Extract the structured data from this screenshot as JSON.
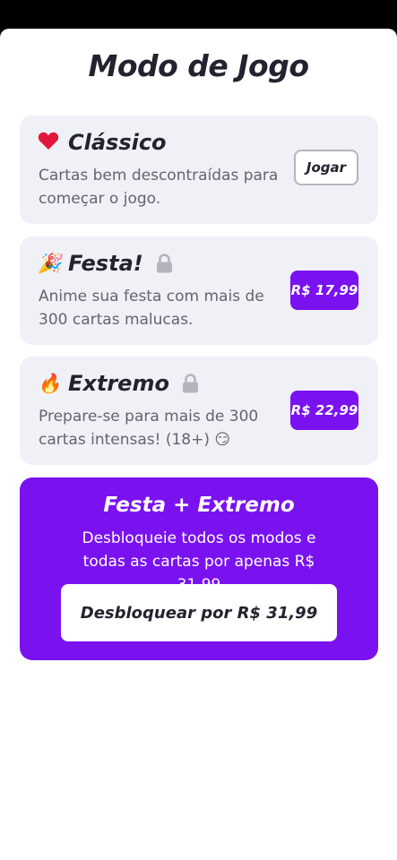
{
  "page_title": "Modo de Jogo",
  "cards": [
    {
      "title": "Clássico",
      "emoji": "❤",
      "description": "Cartas bem descontraídas para começar o jogo.",
      "action_label": "Jogar"
    },
    {
      "title": "Festa!",
      "emoji": "🎉",
      "description": "Anime sua festa com mais de 300 cartas malucas.",
      "action_label": "R$ 17,99",
      "locked": true
    },
    {
      "title": "Extremo",
      "emoji": "🔥",
      "description": "Prepare-se para mais de 300 cartas intensas! (18+) 😏",
      "action_label": "R$ 22,99",
      "locked": true
    }
  ],
  "bundle": {
    "title": "Festa + Extremo",
    "description": "Desbloqueie todos os modos e todas as cartas por apenas R$ 31,99",
    "button_label": "Desbloquear por R$ 31,99"
  },
  "colors": {
    "accent": "#7a12f0",
    "card_bg": "#f0f0f7",
    "heart": "#e0163c",
    "lock": "#b4b4be"
  },
  "icons": [
    "heart-icon",
    "party-popper-icon",
    "fire-icon",
    "lock-icon"
  ]
}
